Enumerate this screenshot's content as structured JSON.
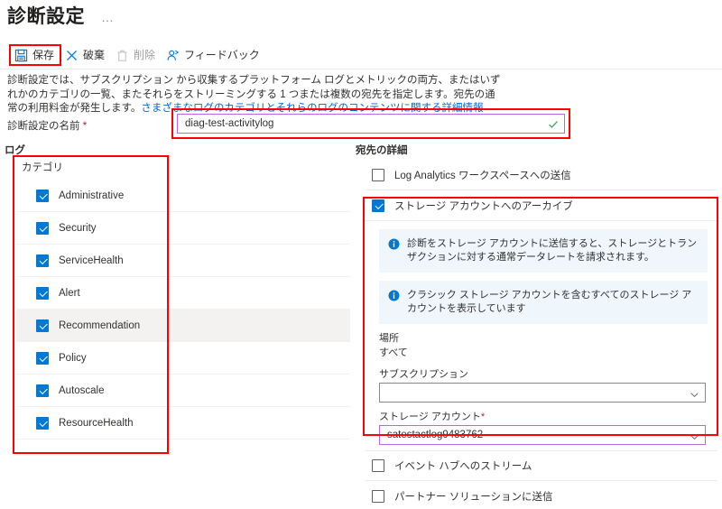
{
  "header": {
    "title": "診断設定",
    "more_menu": "…"
  },
  "toolbar": {
    "items": [
      {
        "label": "保存",
        "icon": "save-icon",
        "disabled": false
      },
      {
        "label": "破棄",
        "icon": "discard-icon",
        "disabled": false
      },
      {
        "label": "削除",
        "icon": "delete-icon",
        "disabled": true
      },
      {
        "label": "フィードバック",
        "icon": "feedback-icon",
        "disabled": false
      }
    ]
  },
  "description": {
    "text_before_link": "診断設定では、サブスクリプション から収集するプラットフォーム ログとメトリックの両方、またはいずれかのカテゴリの一覧、またそれらをストリーミングする 1 つまたは複数の宛先を指定します。宛先の通常の利用料金が発生します。",
    "link_text": "さまざまなログのカテゴリとそれらのログのコンテンツに関する詳細情報"
  },
  "name_field": {
    "label": "診断設定の名前",
    "required_marker": "*",
    "value": "diag-test-activitylog",
    "validation_icon": "green-check-icon"
  },
  "logs": {
    "heading": "ログ",
    "category_header": "カテゴリ",
    "categories": [
      {
        "label": "Administrative",
        "checked": true,
        "highlighted": false
      },
      {
        "label": "Security",
        "checked": true,
        "highlighted": false
      },
      {
        "label": "ServiceHealth",
        "checked": true,
        "highlighted": false
      },
      {
        "label": "Alert",
        "checked": true,
        "highlighted": false
      },
      {
        "label": "Recommendation",
        "checked": true,
        "highlighted": true
      },
      {
        "label": "Policy",
        "checked": true,
        "highlighted": false
      },
      {
        "label": "Autoscale",
        "checked": true,
        "highlighted": false
      },
      {
        "label": "ResourceHealth",
        "checked": true,
        "highlighted": false
      }
    ]
  },
  "destination": {
    "heading": "宛先の詳細",
    "log_analytics": {
      "label": "Log Analytics ワークスペースへの送信",
      "checked": false
    },
    "storage": {
      "label": "ストレージ アカウントへのアーカイブ",
      "checked": true,
      "info_1": "診断をストレージ アカウントに送信すると、ストレージとトランザクションに対する通常データレートを請求されます。",
      "info_2": "クラシック ストレージ アカウントを含むすべてのストレージ アカウントを表示しています",
      "location_label": "場所",
      "location_value": "すべて",
      "subscription_label": "サブスクリプション",
      "subscription_value": "",
      "account_label": "ストレージ アカウント",
      "account_required_marker": "*",
      "account_value": "satestactlog9483762"
    },
    "event_hub": {
      "label": "イベント ハブへのストリーム",
      "checked": false
    },
    "partner": {
      "label": "パートナー ソリューションに送信",
      "checked": false
    }
  },
  "colors": {
    "accent": "#0078d4",
    "annotation": "#ff0000",
    "validation": "#b36ae2",
    "info_bg": "#eff6fc",
    "link": "#0066cc"
  }
}
